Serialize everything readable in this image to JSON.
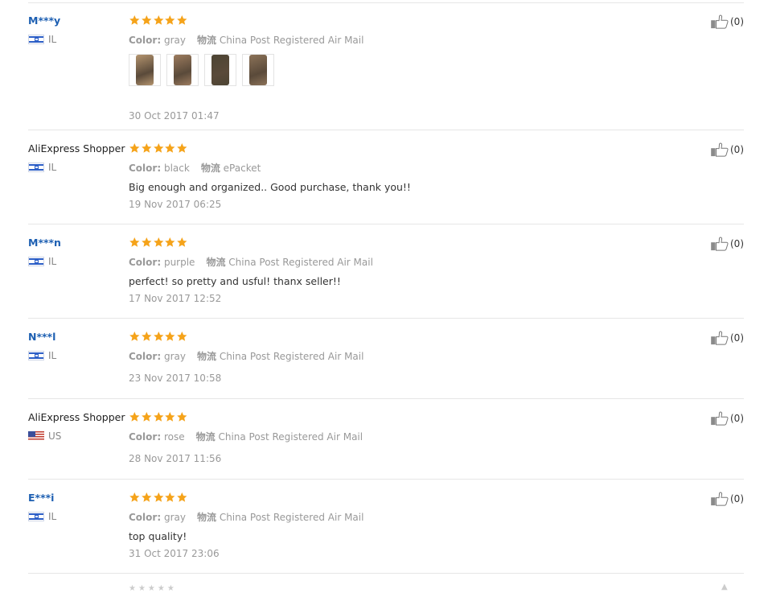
{
  "reviews": [
    {
      "user": "M***y",
      "masked": true,
      "country": "IL",
      "flag": "il",
      "rating": 5,
      "color_label": "Color:",
      "color": "gray",
      "ship_label": "物流",
      "shipping": "China Post Registered Air Mail",
      "text": "",
      "date": "30 Oct 2017 01:47",
      "helpful": "(0)",
      "photos": [
        {
          "tone": "#b4946e"
        },
        {
          "tone": "#9c7b5e"
        },
        {
          "tone": "#4c4433"
        },
        {
          "tone": "#8b7258"
        }
      ]
    },
    {
      "user": "AliExpress Shopper",
      "masked": false,
      "country": "IL",
      "flag": "il",
      "rating": 5,
      "color_label": "Color:",
      "color": "black",
      "ship_label": "物流",
      "shipping": "ePacket",
      "text": "Big enough and organized.. Good purchase, thank you!!",
      "date": "19 Nov 2017 06:25",
      "helpful": "(0)"
    },
    {
      "user": "M***n",
      "masked": true,
      "country": "IL",
      "flag": "il",
      "rating": 5,
      "color_label": "Color:",
      "color": "purple",
      "ship_label": "物流",
      "shipping": "China Post Registered Air Mail",
      "text": "perfect! so pretty and usful! thanx seller!!",
      "date": "17 Nov 2017 12:52",
      "helpful": "(0)"
    },
    {
      "user": "N***l",
      "masked": true,
      "country": "IL",
      "flag": "il",
      "rating": 5,
      "color_label": "Color:",
      "color": "gray",
      "ship_label": "物流",
      "shipping": "China Post Registered Air Mail",
      "text": "",
      "date": "23 Nov 2017 10:58",
      "helpful": "(0)"
    },
    {
      "user": "AliExpress Shopper",
      "masked": false,
      "country": "US",
      "flag": "us",
      "rating": 5,
      "color_label": "Color:",
      "color": "rose",
      "ship_label": "物流",
      "shipping": "China Post Registered Air Mail",
      "text": "",
      "date": "28 Nov 2017 11:56",
      "helpful": "(0)"
    },
    {
      "user": "E***i",
      "masked": true,
      "country": "IL",
      "flag": "il",
      "rating": 5,
      "color_label": "Color:",
      "color": "gray",
      "ship_label": "物流",
      "shipping": "China Post Registered Air Mail",
      "text": "top quality!",
      "date": "31 Oct 2017 23:06",
      "helpful": "(0)"
    }
  ],
  "colors": {
    "star": "#f5a31a",
    "username_link": "#1d5fb2",
    "meta": "#999999",
    "divider": "#e6e6e6"
  }
}
